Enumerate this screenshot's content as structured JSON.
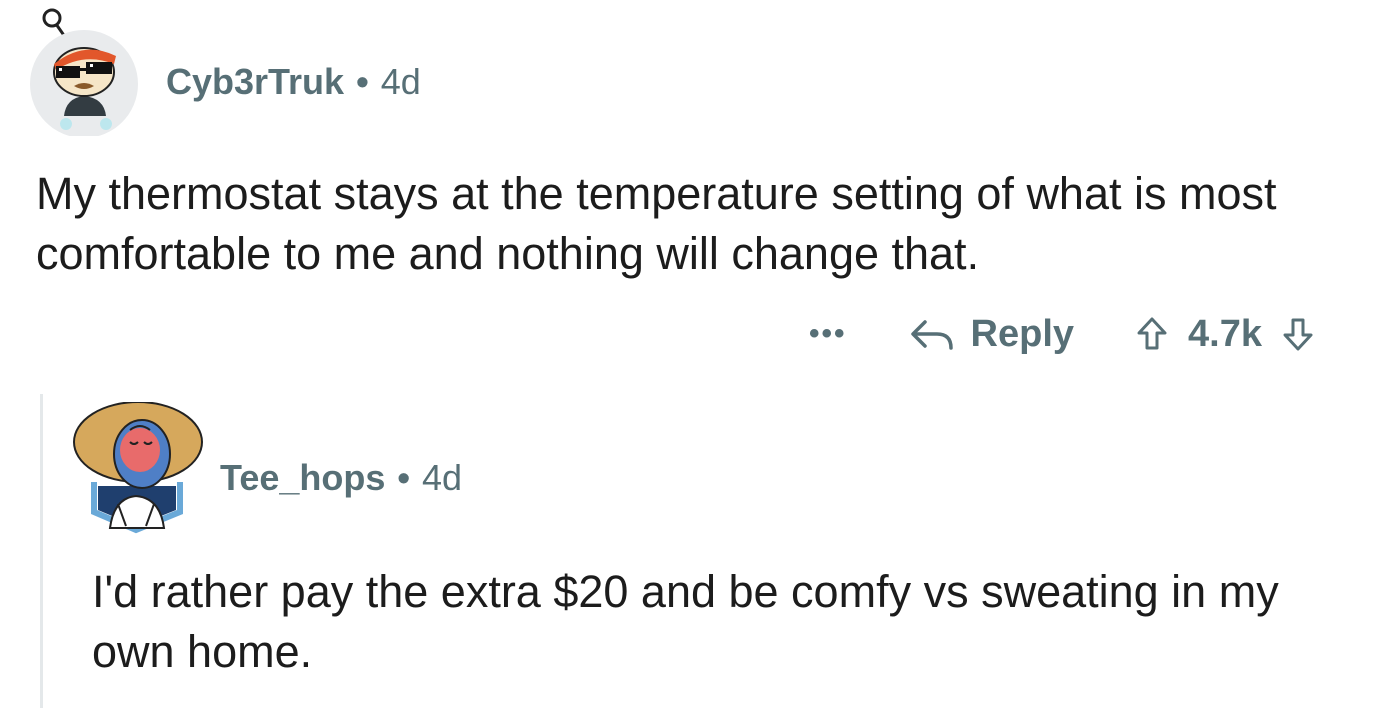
{
  "comments": [
    {
      "username": "Cyb3rTruk",
      "separator": "•",
      "age": "4d",
      "avatar_icon": "snoo-sunglasses-avatar-icon",
      "body": "My thermostat stays at the temperature setting of what is most comfortable to me and nothing will change that.",
      "actions": {
        "more_label": "•••",
        "reply_label": "Reply",
        "vote_count": "4.7k"
      }
    },
    {
      "username": "Tee_hops",
      "separator": "•",
      "age": "4d",
      "avatar_icon": "snoo-afro-avatar-icon",
      "body": "I'd rather pay the extra $20 and be comfy vs sweating in my own home."
    }
  ],
  "colors": {
    "text": "#1c1c1c",
    "meta": "#576f76",
    "thread_line": "#e4e8ea"
  }
}
